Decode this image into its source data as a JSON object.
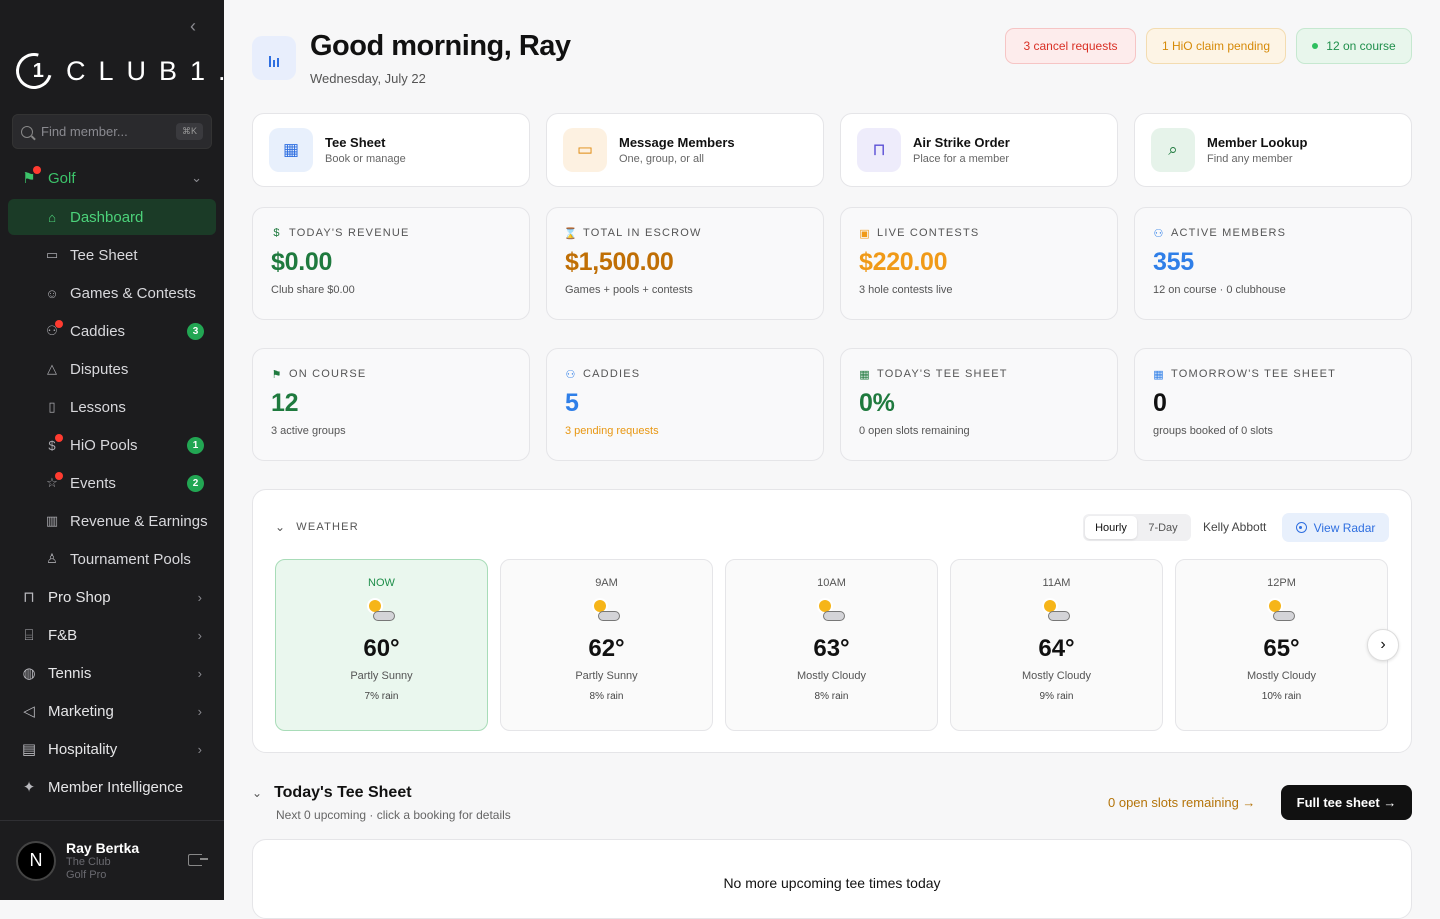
{
  "sidebar": {
    "logo_text": "CLUB1.",
    "logo_mark": "1",
    "search_placeholder": "Find member...",
    "search_shortcut": "⌘K",
    "golf_label": "Golf",
    "items": [
      {
        "label": "Dashboard"
      },
      {
        "label": "Tee Sheet"
      },
      {
        "label": "Games & Contests"
      },
      {
        "label": "Caddies",
        "badge": "3"
      },
      {
        "label": "Disputes"
      },
      {
        "label": "Lessons"
      },
      {
        "label": "HiO Pools",
        "badge": "1"
      },
      {
        "label": "Events",
        "badge": "2"
      },
      {
        "label": "Revenue & Earnings"
      },
      {
        "label": "Tournament Pools"
      }
    ],
    "groups": [
      {
        "label": "Pro Shop"
      },
      {
        "label": "F&B"
      },
      {
        "label": "Tennis"
      },
      {
        "label": "Marketing"
      },
      {
        "label": "Hospitality"
      },
      {
        "label": "Member Intelligence"
      }
    ],
    "user": {
      "initial": "N",
      "name": "Ray Bertka",
      "club": "The Club",
      "role": "Golf Pro"
    }
  },
  "header": {
    "greeting": "Good morning, Ray",
    "date": "Wednesday, July 22",
    "pills": {
      "cancel": "3 cancel requests",
      "hio": "1 HiO claim pending",
      "course": "12 on course"
    }
  },
  "quick_actions": [
    {
      "title": "Tee Sheet",
      "sub": "Book or manage"
    },
    {
      "title": "Message Members",
      "sub": "One, group, or all"
    },
    {
      "title": "Air Strike Order",
      "sub": "Place for a member"
    },
    {
      "title": "Member Lookup",
      "sub": "Find any member"
    }
  ],
  "stats": [
    {
      "label": "TODAY'S REVENUE",
      "value": "$0.00",
      "sub": "Club share $0.00",
      "color": "#1f7a3e"
    },
    {
      "label": "TOTAL IN ESCROW",
      "value": "$1,500.00",
      "sub": "Games + pools + contests",
      "color": "#c06f05"
    },
    {
      "label": "LIVE CONTESTS",
      "value": "$220.00",
      "sub": "3 hole contests live",
      "color": "#f09a18"
    },
    {
      "label": "ACTIVE MEMBERS",
      "value": "355",
      "sub": "12 on course · 0 clubhouse",
      "color": "#2f7fe8"
    },
    {
      "label": "ON COURSE",
      "value": "12",
      "sub": "3 active groups",
      "color": "#1f7a3e"
    },
    {
      "label": "CADDIES",
      "value": "5",
      "sub": "3 pending requests",
      "color": "#2f7fe8"
    },
    {
      "label": "TODAY'S TEE SHEET",
      "value": "0%",
      "sub": "0 open slots remaining",
      "color": "#1f7a3e"
    },
    {
      "label": "TOMORROW'S TEE SHEET",
      "value": "0",
      "sub": "groups booked of 0 slots",
      "color": "#111111"
    }
  ],
  "weather": {
    "title": "WEATHER",
    "toggle": [
      "Hourly",
      "7-Day"
    ],
    "location": "Kelly Abbott",
    "radar": "View Radar",
    "hours": [
      {
        "time": "NOW",
        "temp": "60°",
        "cond": "Partly Sunny",
        "rain": "7% rain"
      },
      {
        "time": "9AM",
        "temp": "62°",
        "cond": "Partly Sunny",
        "rain": "8% rain"
      },
      {
        "time": "10AM",
        "temp": "63°",
        "cond": "Mostly Cloudy",
        "rain": "8% rain"
      },
      {
        "time": "11AM",
        "temp": "64°",
        "cond": "Mostly Cloudy",
        "rain": "9% rain"
      },
      {
        "time": "12PM",
        "temp": "65°",
        "cond": "Mostly Cloudy",
        "rain": "10% rain"
      }
    ]
  },
  "tee_sheet": {
    "title": "Today's Tee Sheet",
    "sub": "Next 0 upcoming · click a booking for details",
    "open_link": "0 open slots remaining →",
    "full_button": "Full tee sheet →",
    "empty": "No more upcoming tee times today"
  }
}
